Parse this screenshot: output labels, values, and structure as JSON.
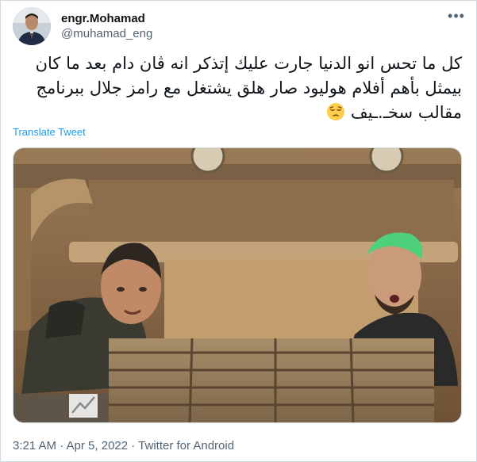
{
  "author": {
    "display_name": "engr.Mohamad",
    "handle": "@muhamad_eng"
  },
  "tweet": {
    "text": "كل ما تحس انو الدنيا جارت عليك إتذكر انه ڤان دام بعد ما كان بيمثل بأهم أفلام هوليود صار هلق يشتغل مع رامز جلال ببرنامج مقالب سخـ.ـيف",
    "emoji": "pensive-face-emoji",
    "translate_label": "Translate Tweet",
    "timestamp": "3:21 AM · Apr 5, 2022",
    "source": "Twitter for Android"
  },
  "colors": {
    "link": "#1d9bf0",
    "secondary_text": "#536471",
    "border": "#cfd9de"
  },
  "icons": {
    "more": "more-horizontal-icon",
    "image_watermark": "watermark-logo-icon"
  }
}
